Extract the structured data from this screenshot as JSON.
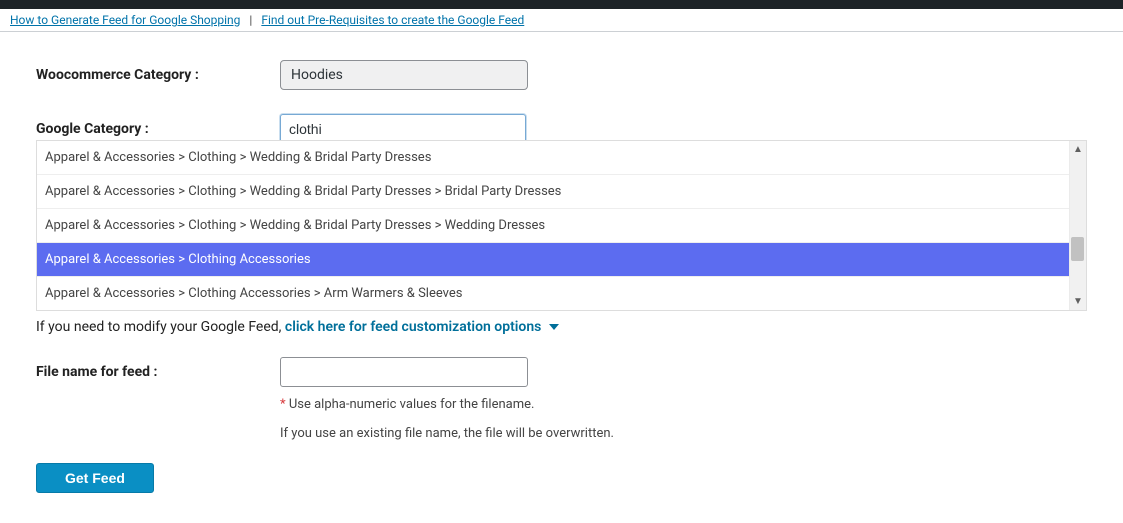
{
  "topLinks": {
    "link1": "How to Generate Feed for Google Shopping",
    "sep": "|",
    "link2": "Find out Pre-Requisites to create the Google Feed"
  },
  "form": {
    "wooLabel": "Woocommerce Category :",
    "wooValue": "Hoodies",
    "googleLabel": "Google Category :",
    "googleValue": "clothi",
    "dropdown": [
      "Apparel & Accessories > Clothing > Wedding & Bridal Party Dresses",
      "Apparel & Accessories > Clothing > Wedding & Bridal Party Dresses > Bridal Party Dresses",
      "Apparel & Accessories > Clothing > Wedding & Bridal Party Dresses > Wedding Dresses",
      "Apparel & Accessories > Clothing Accessories",
      "Apparel & Accessories > Clothing Accessories > Arm Warmers & Sleeves"
    ],
    "dropdownSelectedIndex": 3,
    "modifyLead": "If you need to modify your Google Feed, ",
    "modifyLink": "click here for feed customization options",
    "fileLabel": "File name for feed :",
    "fileValue": "",
    "hintAsterisk": "*",
    "hint1": " Use alpha-numeric values for the filename.",
    "hint2": "If you use an existing file name, the file will be overwritten.",
    "submitLabel": "Get Feed"
  }
}
